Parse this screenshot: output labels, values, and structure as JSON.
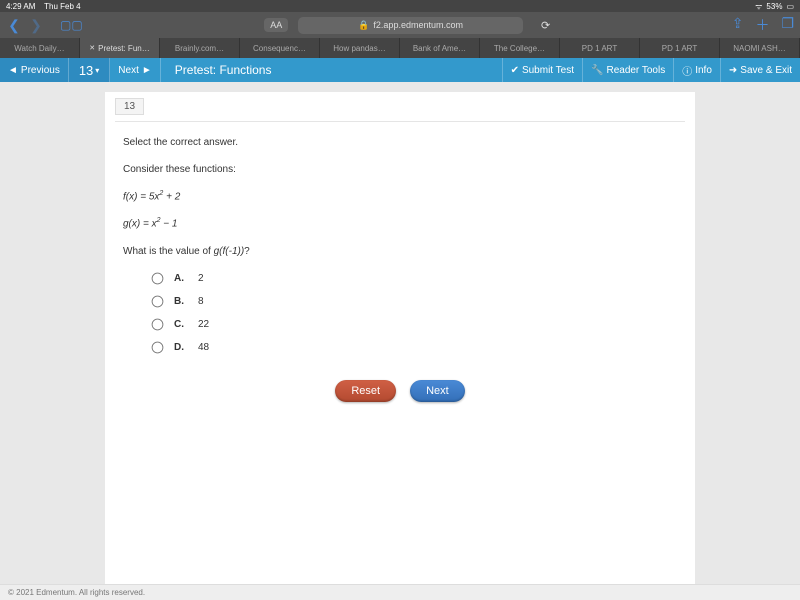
{
  "status": {
    "time": "4:29 AM",
    "date": "Thu Feb 4",
    "battery": "53%"
  },
  "browser": {
    "url": "f2.app.edmentum.com",
    "aa": "AA",
    "tabs": [
      "Watch Daily…",
      "Pretest: Fun…",
      "Brainly.com…",
      "Consequenc…",
      "How pandas…",
      "Bank of Ame…",
      "The College…",
      "PD 1 ART",
      "PD 1 ART",
      "NAOMI ASH…"
    ]
  },
  "appbar": {
    "prev": "Previous",
    "qnum": "13",
    "next": "Next",
    "title": "Pretest: Functions",
    "submit": "Submit Test",
    "tools": "Reader Tools",
    "info": "Info",
    "save": "Save & Exit"
  },
  "question": {
    "number": "13",
    "prompt": "Select the correct answer.",
    "intro": "Consider these functions:",
    "f_lhs": "f(x) = 5x",
    "f_exp": "2",
    "f_tail": " + 2",
    "g_lhs": "g(x) = x",
    "g_exp": "2",
    "g_tail": " − 1",
    "ask_pre": "What is the value of ",
    "ask_mid": "g(f(-1))",
    "ask_post": "?",
    "choices": [
      {
        "label": "A.",
        "value": "2"
      },
      {
        "label": "B.",
        "value": "8"
      },
      {
        "label": "C.",
        "value": "22"
      },
      {
        "label": "D.",
        "value": "48"
      }
    ],
    "reset": "Reset",
    "nextbtn": "Next"
  },
  "footer": "© 2021 Edmentum. All rights reserved."
}
